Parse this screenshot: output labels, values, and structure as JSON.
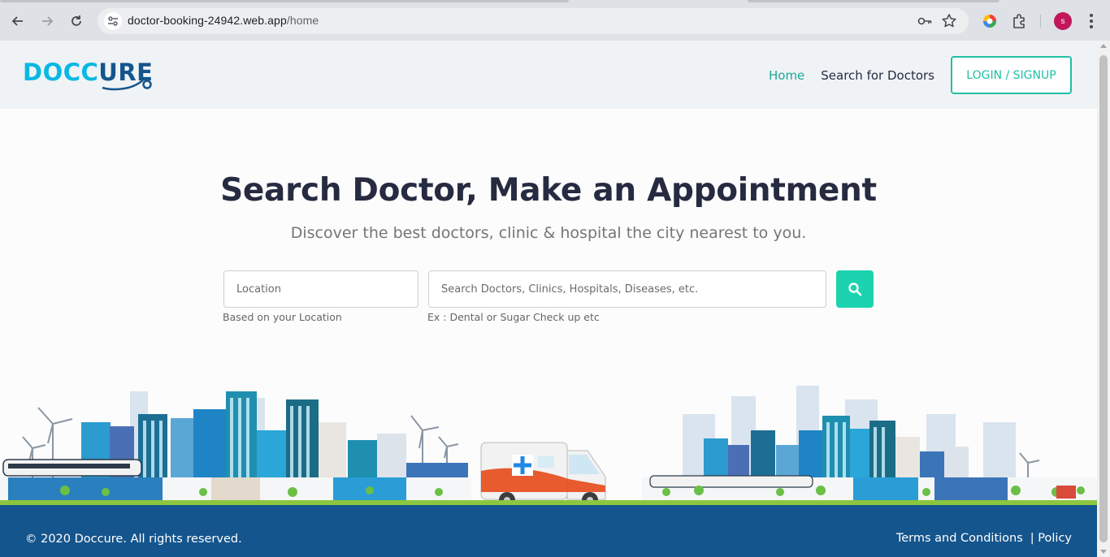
{
  "browser": {
    "url_host": "doctor-booking-24942.web.app",
    "url_path": "/home",
    "profile_initial": "s",
    "icons": [
      "back-icon",
      "forward-icon",
      "reload-icon",
      "site-info-icon",
      "password-key-icon",
      "bookmark-star-icon",
      "extension-color-icon",
      "extensions-puzzle-icon",
      "menu-kebab-icon"
    ]
  },
  "header": {
    "logo_part1": "DOCC",
    "logo_part2": "URE",
    "nav": {
      "home": "Home",
      "search_doctors": "Search for Doctors",
      "login": "LOGIN / SIGNUP"
    }
  },
  "hero": {
    "title": "Search Doctor, Make an Appointment",
    "subtitle": "Discover the best doctors, clinic & hospital the city nearest to you.",
    "location_placeholder": "Location",
    "location_hint": "Based on your Location",
    "query_placeholder": "Search Doctors, Clinics, Hospitals, Diseases, etc.",
    "query_hint": "Ex : Dental or Sugar Check up etc"
  },
  "footer": {
    "copyright": "© 2020 Doccure. All rights reserved.",
    "terms": "Terms and Conditions",
    "policy": "| Policy"
  },
  "colors": {
    "accent_teal": "#20c0a5",
    "search_button": "#1cd3b0",
    "footer_blue": "#15558d",
    "logo_cyan": "#09b8e3",
    "title_dark": "#272b41"
  }
}
